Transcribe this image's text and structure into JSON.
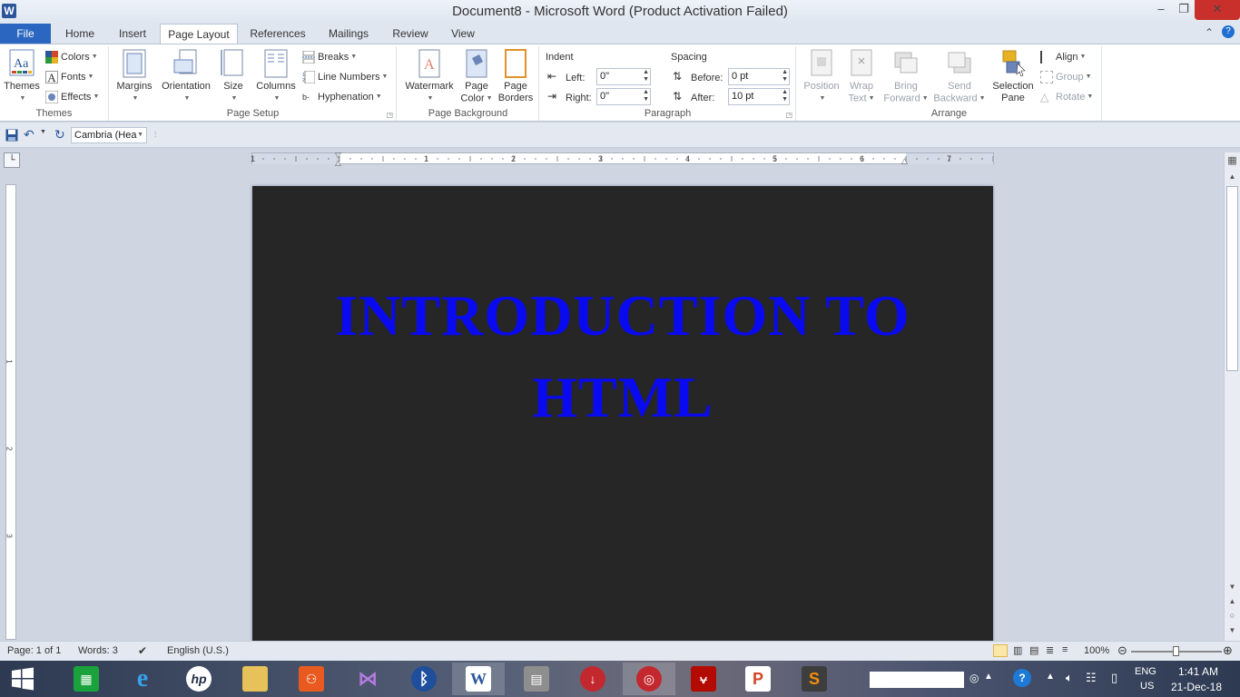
{
  "window": {
    "title": "Document8  -  Microsoft Word (Product Activation Failed)",
    "app_icon_letter": "W"
  },
  "tabs": [
    "File",
    "Home",
    "Insert",
    "Page Layout",
    "References",
    "Mailings",
    "Review",
    "View"
  ],
  "active_tab": "Page Layout",
  "ribbon": {
    "themes": {
      "label": "Themes",
      "themes_btn": "Themes",
      "colors": "Colors",
      "fonts": "Fonts",
      "effects": "Effects"
    },
    "page_setup": {
      "label": "Page Setup",
      "margins": "Margins",
      "orientation": "Orientation",
      "size": "Size",
      "columns": "Columns",
      "breaks": "Breaks",
      "line_numbers": "Line Numbers",
      "hyphenation": "Hyphenation"
    },
    "page_background": {
      "label": "Page Background",
      "watermark": "Watermark",
      "page_color_1": "Page",
      "page_color_2": "Color",
      "page_borders_1": "Page",
      "page_borders_2": "Borders"
    },
    "paragraph": {
      "label": "Paragraph",
      "indent_title": "Indent",
      "spacing_title": "Spacing",
      "left_label": "Left:",
      "left_value": "0\"",
      "right_label": "Right:",
      "right_value": "0\"",
      "before_label": "Before:",
      "before_value": "0 pt",
      "after_label": "After:",
      "after_value": "10 pt"
    },
    "arrange": {
      "label": "Arrange",
      "position": "Position",
      "wrap_1": "Wrap",
      "wrap_2": "Text",
      "bring_1": "Bring",
      "bring_2": "Forward",
      "send_1": "Send",
      "send_2": "Backward",
      "selection_1": "Selection",
      "selection_2": "Pane",
      "align": "Align",
      "group": "Group",
      "rotate": "Rotate"
    }
  },
  "qat": {
    "font_name": "Cambria (Hea"
  },
  "ruler": {
    "numbers": [
      "1",
      "1",
      "2",
      "3",
      "4",
      "5",
      "6",
      "7"
    ],
    "vnumbers": [
      "1",
      "2",
      "3"
    ]
  },
  "document": {
    "heading_line1": "INTRODUCTION TO",
    "heading_line2": "HTML",
    "page_color": "#262626",
    "heading_color": "#0a0af0"
  },
  "status": {
    "page": "Page: 1 of 1",
    "words": "Words: 3",
    "language": "English (U.S.)",
    "zoom": "100%"
  },
  "taskbar": {
    "apps": [
      "start-icon",
      "store-icon",
      "internet-explorer-icon",
      "hp-icon",
      "file-explorer-icon",
      "voice-recorder-icon",
      "visual-studio-icon",
      "bluetooth-icon",
      "word-icon",
      "firewall-icon",
      "downloader-icon",
      "antivirus-icon",
      "acrobat-icon",
      "powerpoint-icon",
      "sublime-text-icon"
    ],
    "lang_1": "ENG",
    "lang_2": "US",
    "time": "1:41 AM",
    "date": "21-Dec-18"
  }
}
